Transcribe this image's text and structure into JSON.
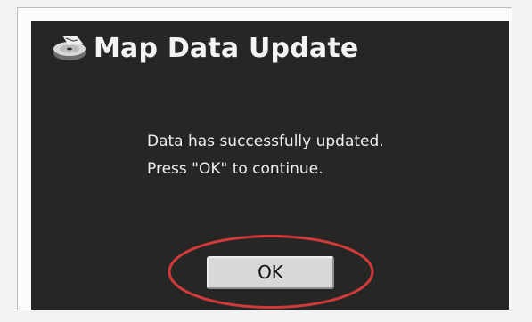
{
  "dialog": {
    "title": "Map Data Update",
    "message_lines": [
      "Data has successfully updated.",
      "Press \"OK\" to continue."
    ],
    "ok_label": "OK",
    "icon": "map-disc-icon"
  },
  "colors": {
    "screen_background": "#262625",
    "text": "#efefef",
    "button_face": "#d8d8d8",
    "highlight": "#d23a3a"
  }
}
